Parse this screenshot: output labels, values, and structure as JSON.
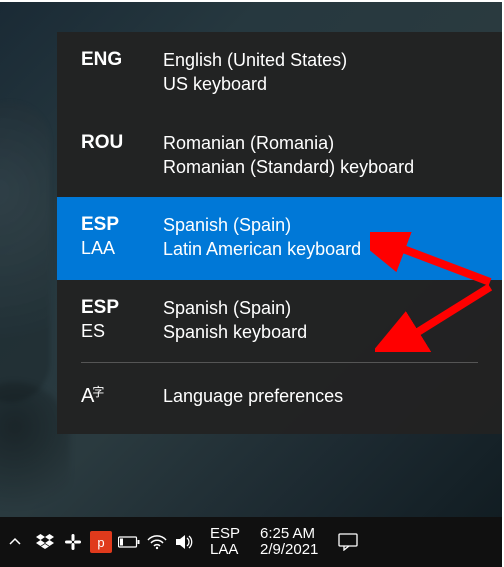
{
  "flyout": {
    "items": [
      {
        "code_a": "ENG",
        "code_b": "",
        "line_a": "English (United States)",
        "line_b": "US keyboard",
        "selected": false
      },
      {
        "code_a": "ROU",
        "code_b": "",
        "line_a": "Romanian (Romania)",
        "line_b": "Romanian (Standard) keyboard",
        "selected": false
      },
      {
        "code_a": "ESP",
        "code_b": "LAA",
        "line_a": "Spanish (Spain)",
        "line_b": "Latin American keyboard",
        "selected": true
      },
      {
        "code_a": "ESP",
        "code_b": "ES",
        "line_a": "Spanish (Spain)",
        "line_b": "Spanish keyboard",
        "selected": false
      }
    ],
    "prefs_label": "Language preferences"
  },
  "taskbar": {
    "lang_code_a": "ESP",
    "lang_code_b": "LAA",
    "time": "6:25 AM",
    "date": "2/9/2021"
  }
}
